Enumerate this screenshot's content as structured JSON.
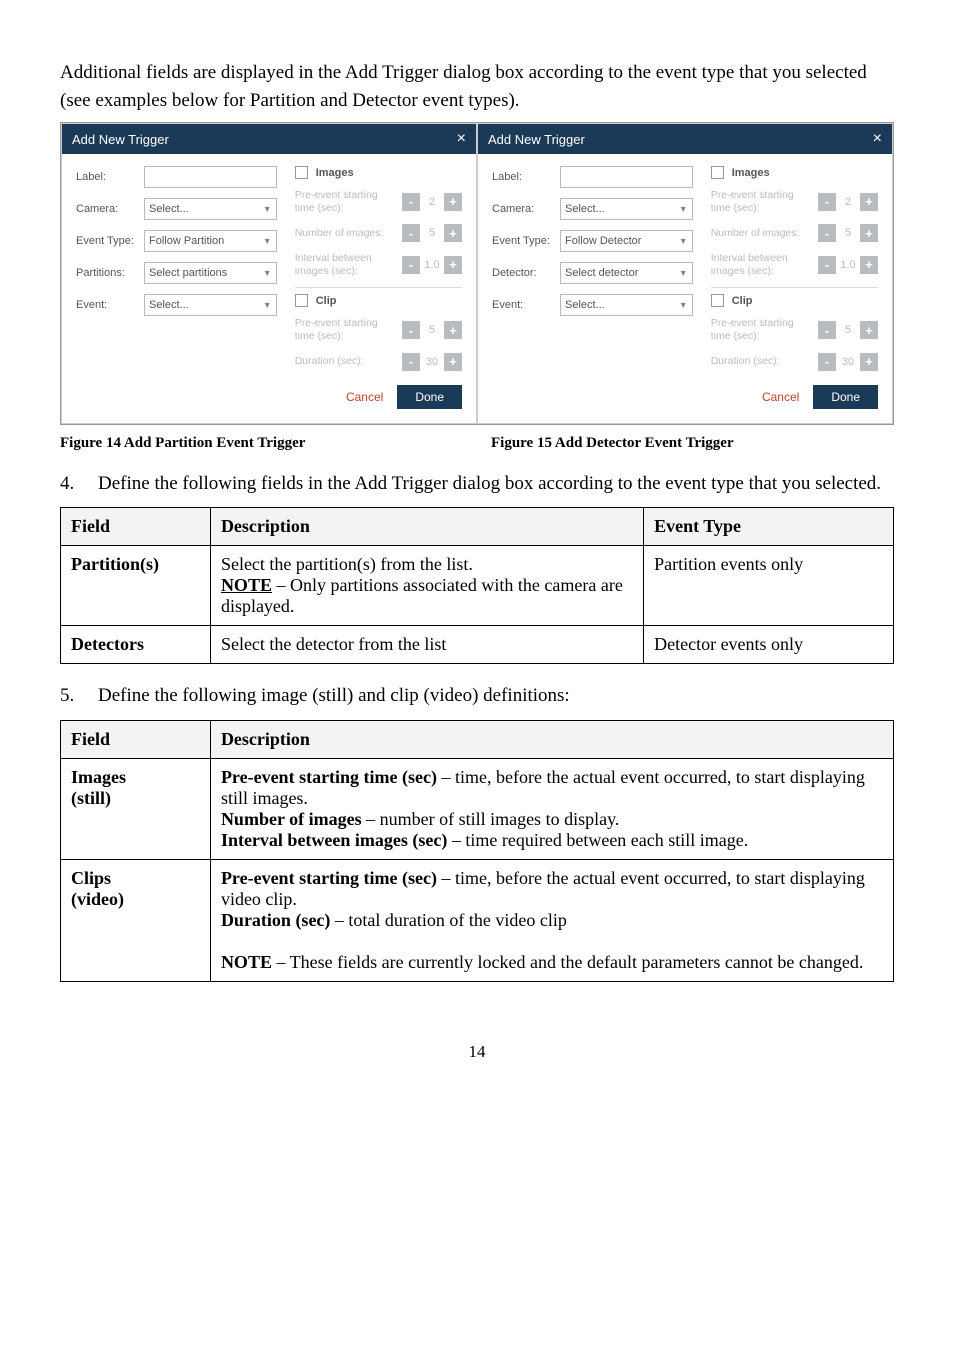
{
  "intro": "Additional fields are displayed in the Add Trigger dialog box according to the event type that you selected (see examples below for Partition and Detector event types).",
  "dialogA": {
    "title": "Add New Trigger",
    "label_lbl": "Label:",
    "camera_lbl": "Camera:",
    "camera_val": "Select...",
    "eventtype_lbl": "Event Type:",
    "eventtype_val": "Follow Partition",
    "partitions_lbl": "Partitions:",
    "partitions_val": "Select partitions",
    "event_lbl": "Event:",
    "event_val": "Select...",
    "images_title": "Images",
    "pre_lbl": "Pre-event starting time (sec):",
    "pre_val": "2",
    "numimg_lbl": "Number of images:",
    "numimg_val": "5",
    "interval_lbl": "Interval between images (sec):",
    "interval_val": "1.0",
    "clip_title": "Clip",
    "clip_pre_lbl": "Pre-event starting time (sec):",
    "clip_pre_val": "5",
    "dur_lbl": "Duration (sec):",
    "dur_val": "30",
    "cancel": "Cancel",
    "done": "Done"
  },
  "dialogB": {
    "title": "Add New Trigger",
    "label_lbl": "Label:",
    "camera_lbl": "Camera:",
    "camera_val": "Select...",
    "eventtype_lbl": "Event Type:",
    "eventtype_val": "Follow Detector",
    "detector_lbl": "Detector:",
    "detector_val": "Select detector",
    "event_lbl": "Event:",
    "event_val": "Select...",
    "images_title": "Images",
    "pre_lbl": "Pre-event starting time (sec):",
    "pre_val": "2",
    "numimg_lbl": "Number of images:",
    "numimg_val": "5",
    "interval_lbl": "Interval between images (sec):",
    "interval_val": "1.0",
    "clip_title": "Clip",
    "clip_pre_lbl": "Pre-event starting time (sec):",
    "clip_pre_val": "5",
    "dur_lbl": "Duration (sec):",
    "dur_val": "30",
    "cancel": "Cancel",
    "done": "Done"
  },
  "fig14": "Figure 14 Add Partition Event Trigger",
  "fig15": "Figure 15 Add Detector Event Trigger",
  "step4_num": "4.",
  "step4_txt": "Define the following fields in the Add Trigger dialog box according to the event type that you selected.",
  "table1": {
    "h1": "Field",
    "h2": "Description",
    "h3": "Event Type",
    "r1c1": "Partition(s)",
    "r1c2a": "Select the partition(s) from the list.",
    "r1c2b_label": "NOTE",
    "r1c2b_rest": " – Only partitions associated with the camera are displayed.",
    "r1c3": "Partition events only",
    "r2c1": "Detectors",
    "r2c2": "Select the detector from the list",
    "r2c3": "Detector events only"
  },
  "step5_num": "5.",
  "step5_txt": "Define the following image (still) and clip (video) definitions:",
  "table2": {
    "h1": "Field",
    "h2": "Description",
    "r1c1a": "Images",
    "r1c1b": "(still)",
    "r1_l1a": "Pre-event starting time (sec)",
    "r1_l1b": " – time, before the actual event occurred, to start displaying still images.",
    "r1_l2a": "Number of images",
    "r1_l2b": " – number of still images to display.",
    "r1_l3a": "Interval between images (sec)",
    "r1_l3b": " – time required between each still image.",
    "r2c1a": "Clips",
    "r2c1b": "(video)",
    "r2_l1a": "Pre-event starting time (sec)",
    "r2_l1b": " – time, before the actual event occurred, to start displaying video clip.",
    "r2_l2a": "Duration (sec)",
    "r2_l2b": " – total duration of the video clip",
    "r2_l3a": "NOTE",
    "r2_l3b": " – These fields are currently locked and the default parameters cannot be changed."
  },
  "page": "14"
}
